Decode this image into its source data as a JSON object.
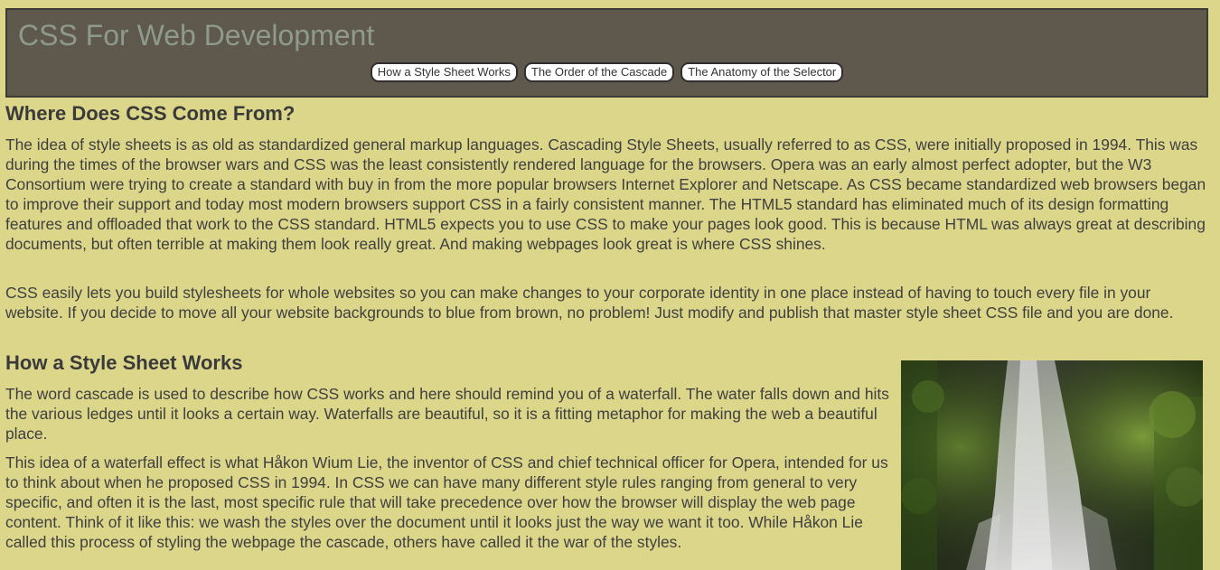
{
  "header": {
    "title": "CSS For Web Development",
    "nav": [
      {
        "label": "How a Style Sheet Works"
      },
      {
        "label": "The Order of the Cascade"
      },
      {
        "label": "The Anatomy of the Selector"
      }
    ]
  },
  "sections": {
    "where": {
      "heading": "Where Does CSS Come From?",
      "p1": "The idea of style sheets is as old as standardized general markup languages. Cascading Style Sheets, usually referred to as CSS, were initially proposed in 1994. This was during the times of the browser wars and CSS was the least consistently rendered language for the browsers. Opera was an early almost perfect adopter, but the W3 Consortium were trying to create a standard with buy in from the more popular browsers Internet Explorer and Netscape. As CSS became standardized web browsers began to improve their support and today most modern browsers support CSS in a fairly consistent manner. The HTML5 standard has eliminated much of its design formatting features and offloaded that work to the CSS standard. HTML5 expects you to use CSS to make your pages look good. This is because HTML was always great at describing documents, but often terrible at making them look really great. And making webpages look great is where CSS shines.",
      "p2": "CSS easily lets you build stylesheets for whole websites so you can make changes to your corporate identity in one place instead of having to touch every file in your website. If you decide to move all your website backgrounds to blue from brown, no problem! Just modify and publish that master style sheet CSS file and you are done."
    },
    "how": {
      "heading": "How a Style Sheet Works",
      "p1": "The word cascade is used to describe how CSS works and here should remind you of a waterfall. The water falls down and hits the various ledges until it looks a certain way. Waterfalls are beautiful, so it is a fitting metaphor for making the web a beautiful place.",
      "p2": "This idea of a waterfall effect is what Håkon Wium Lie, the inventor of CSS and chief technical officer for Opera, intended for us to think about when he proposed CSS in 1994. In CSS we can have many different style rules ranging from general to very specific, and often it is the last, most specific rule that will take precedence over how the browser will display the web page content. Think of it like this: we wash the styles over the document until it looks just the way we want it too. While Håkon Lie called this process of styling the webpage the cascade, others have called it the war of the styles."
    }
  },
  "colors": {
    "page_background": "#dcd68b",
    "header_background": "#5f584c",
    "title_text": "#8f9a8e",
    "body_text": "#3f3f3f"
  }
}
